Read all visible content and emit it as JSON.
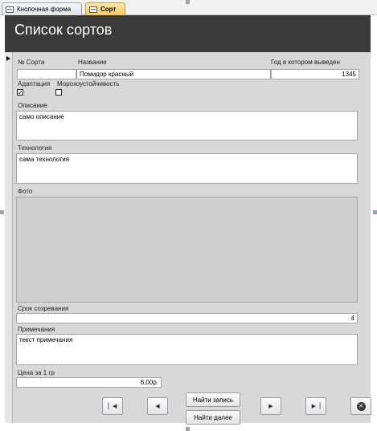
{
  "tabs": [
    {
      "label": "Кнопочная форма",
      "active": false
    },
    {
      "label": "Сорт",
      "active": true
    }
  ],
  "header": {
    "title": "Список сортов"
  },
  "fields": {
    "sort_no": {
      "label": "№ Сорта",
      "value": ""
    },
    "name": {
      "label": "Название",
      "value": "Помидор красный"
    },
    "year": {
      "label": "Год в котором выведен",
      "value": "1345"
    },
    "adaptation": {
      "label": "Адаптация",
      "checked": true
    },
    "frost": {
      "label": "Морозоустойчивость",
      "checked": false
    },
    "description": {
      "label": "Описание",
      "value": "само описание"
    },
    "technology": {
      "label": "Технология",
      "value": "сама технология"
    },
    "photo": {
      "label": "Фото"
    },
    "ripening": {
      "label": "Срок созревания",
      "value": "4"
    },
    "notes": {
      "label": "Примечания",
      "value": "текст примечания"
    },
    "price": {
      "label": "Цена за 1 гр",
      "value": "6,00р."
    }
  },
  "buttons": {
    "find_record": "Найти запись",
    "find_next": "Найти далее"
  },
  "icons": {
    "first": "first-record-icon",
    "prev": "previous-record-icon",
    "next": "next-record-icon",
    "last": "last-record-icon",
    "close": "close-form-icon"
  },
  "colors": {
    "header_bg": "#3a3a3a",
    "header_text": "#ffffff",
    "form_bg": "#d8d8d8",
    "active_tab": "#f8c95c"
  }
}
